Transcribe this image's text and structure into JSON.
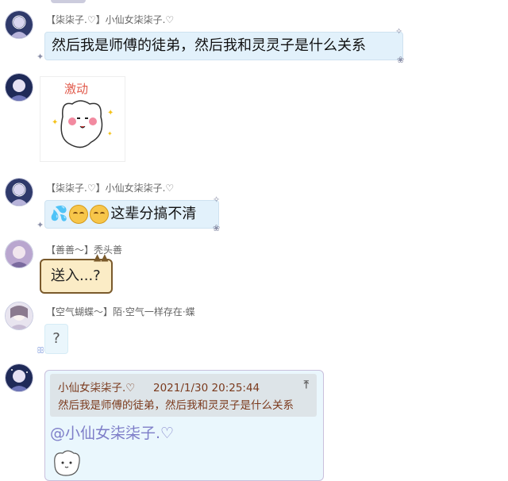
{
  "messages": [
    {
      "sender": "【柒柒子.♡】小仙女柒柒子.♡",
      "text": "然后我是师傅的徒弟，然后我和灵灵子是什么关系"
    },
    {
      "sticker_label": "激动"
    },
    {
      "sender": "【柒柒子.♡】小仙女柒柒子.♡",
      "text": "这辈分搞不清"
    },
    {
      "sender": "【善善～】秃头善",
      "text": "送入...?"
    },
    {
      "sender": "【空气蝴蝶～】陌·空气一样存在·蝶",
      "text": "?"
    },
    {
      "quote": {
        "author": "小仙女柒柒子.♡",
        "time": "2021/1/30 20:25:44",
        "text": "然后我是师傅的徒弟，然后我和灵灵子是什么关系"
      },
      "mention": "@小仙女柒柒子.♡"
    }
  ],
  "icons": [
    "avatar",
    "sparkle-icon",
    "sweat-drops-icon",
    "grin-emoji",
    "pin-top-icon",
    "cat-sticker"
  ],
  "colors": {
    "bubble_blue": "#e2f1fb",
    "bubble_yellow": "#fbecc6",
    "quote_text": "#7b3a1d",
    "mention": "#7d7dc8"
  }
}
